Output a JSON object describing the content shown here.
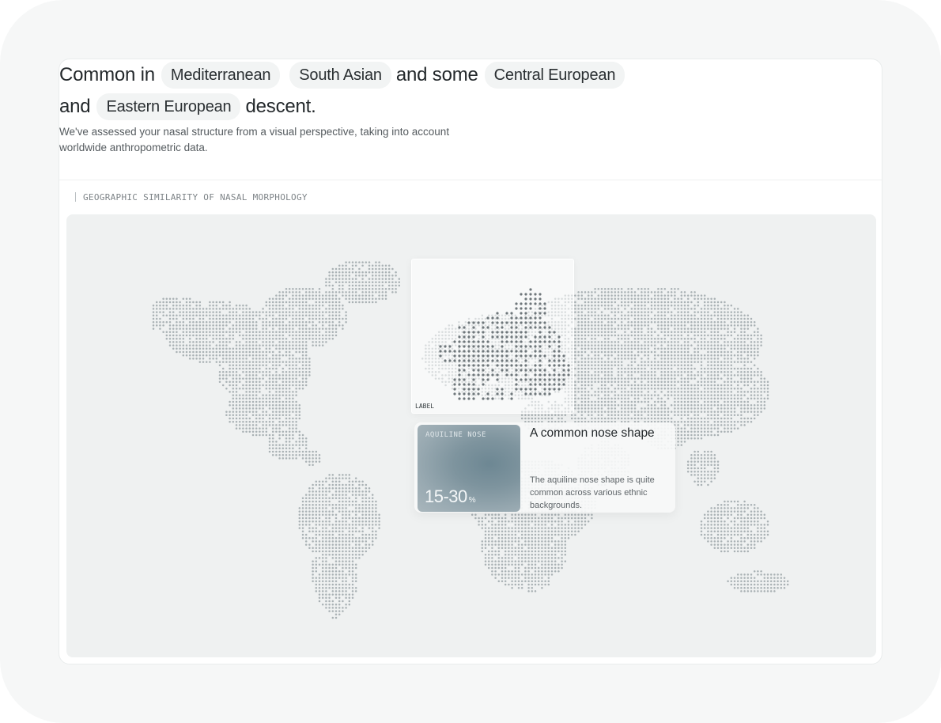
{
  "headline": {
    "prefix": "Common in",
    "connector_1": "and some",
    "connector_2": "and",
    "suffix": "descent.",
    "regions": [
      "Mediterranean",
      "South Asian",
      "Central European",
      "Eastern European"
    ]
  },
  "description": "We've assessed your nasal structure from a visual perspective, taking into account worldwide anthropometric data.",
  "section_label": "GEOGRAPHIC SIMILARITY OF NASAL MORPHOLOGY",
  "map": {
    "zoom_label": "LABEL",
    "dot_color": "#a9b1b4",
    "zoom_dot_color": "#6f777b"
  },
  "info_card": {
    "tile_label": "AQUILINE NOSE",
    "value": "15-30",
    "unit": "%",
    "title": "A common nose shape",
    "text": "The aquiline nose shape is quite common across various ethnic backgrounds."
  },
  "colors": {
    "frame": "#f6f7f7",
    "map_background": "#eff1f1",
    "pill": "#f2f4f4",
    "tile_accent": "#6d8793"
  }
}
